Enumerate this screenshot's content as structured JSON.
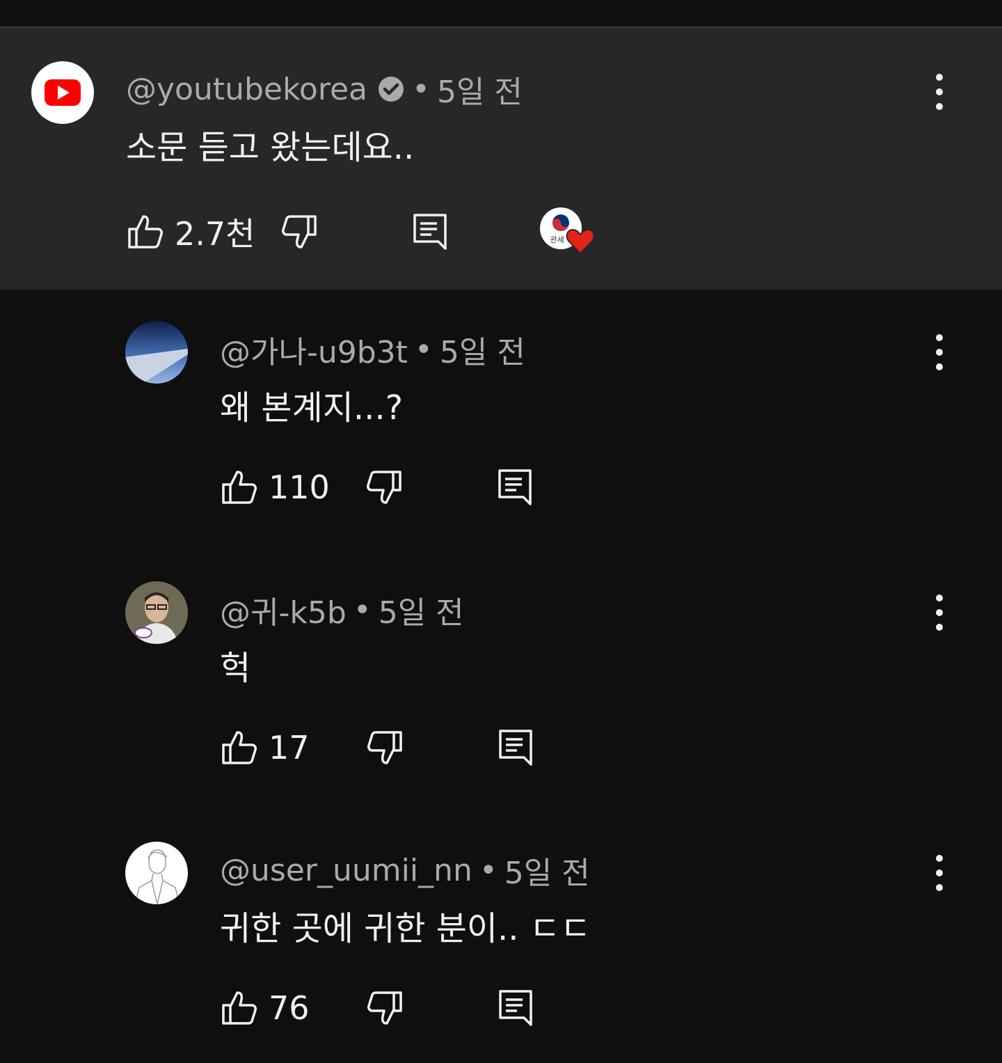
{
  "comments": [
    {
      "handle": "@youtubekorea",
      "verified": true,
      "separator": "•",
      "time": "5일 전",
      "text": "소문 듣고 왔는데요..",
      "likes": "2.7천",
      "avatar_icon": "youtube-logo-icon",
      "creator_heart": {
        "avatar_label": "관세",
        "icon": "heart-icon",
        "color": "#e62117"
      }
    },
    {
      "handle": "@가나-u9b3t",
      "separator": "•",
      "time": "5일 전",
      "text": "왜 본계지...?",
      "likes": "110"
    },
    {
      "handle": "@귀-k5b",
      "separator": "•",
      "time": "5일 전",
      "text": "헉",
      "likes": "17"
    },
    {
      "handle": "@user_uumii_nn",
      "separator": "•",
      "time": "5일 전",
      "text": "귀한 곳에 귀한 분이.. ㄷㄷ",
      "likes": "76"
    }
  ],
  "colors": {
    "background": "#0f0f0f",
    "highlight": "#272727",
    "youtube_red": "#ff0000",
    "secondary_text": "#aaaaaa"
  }
}
